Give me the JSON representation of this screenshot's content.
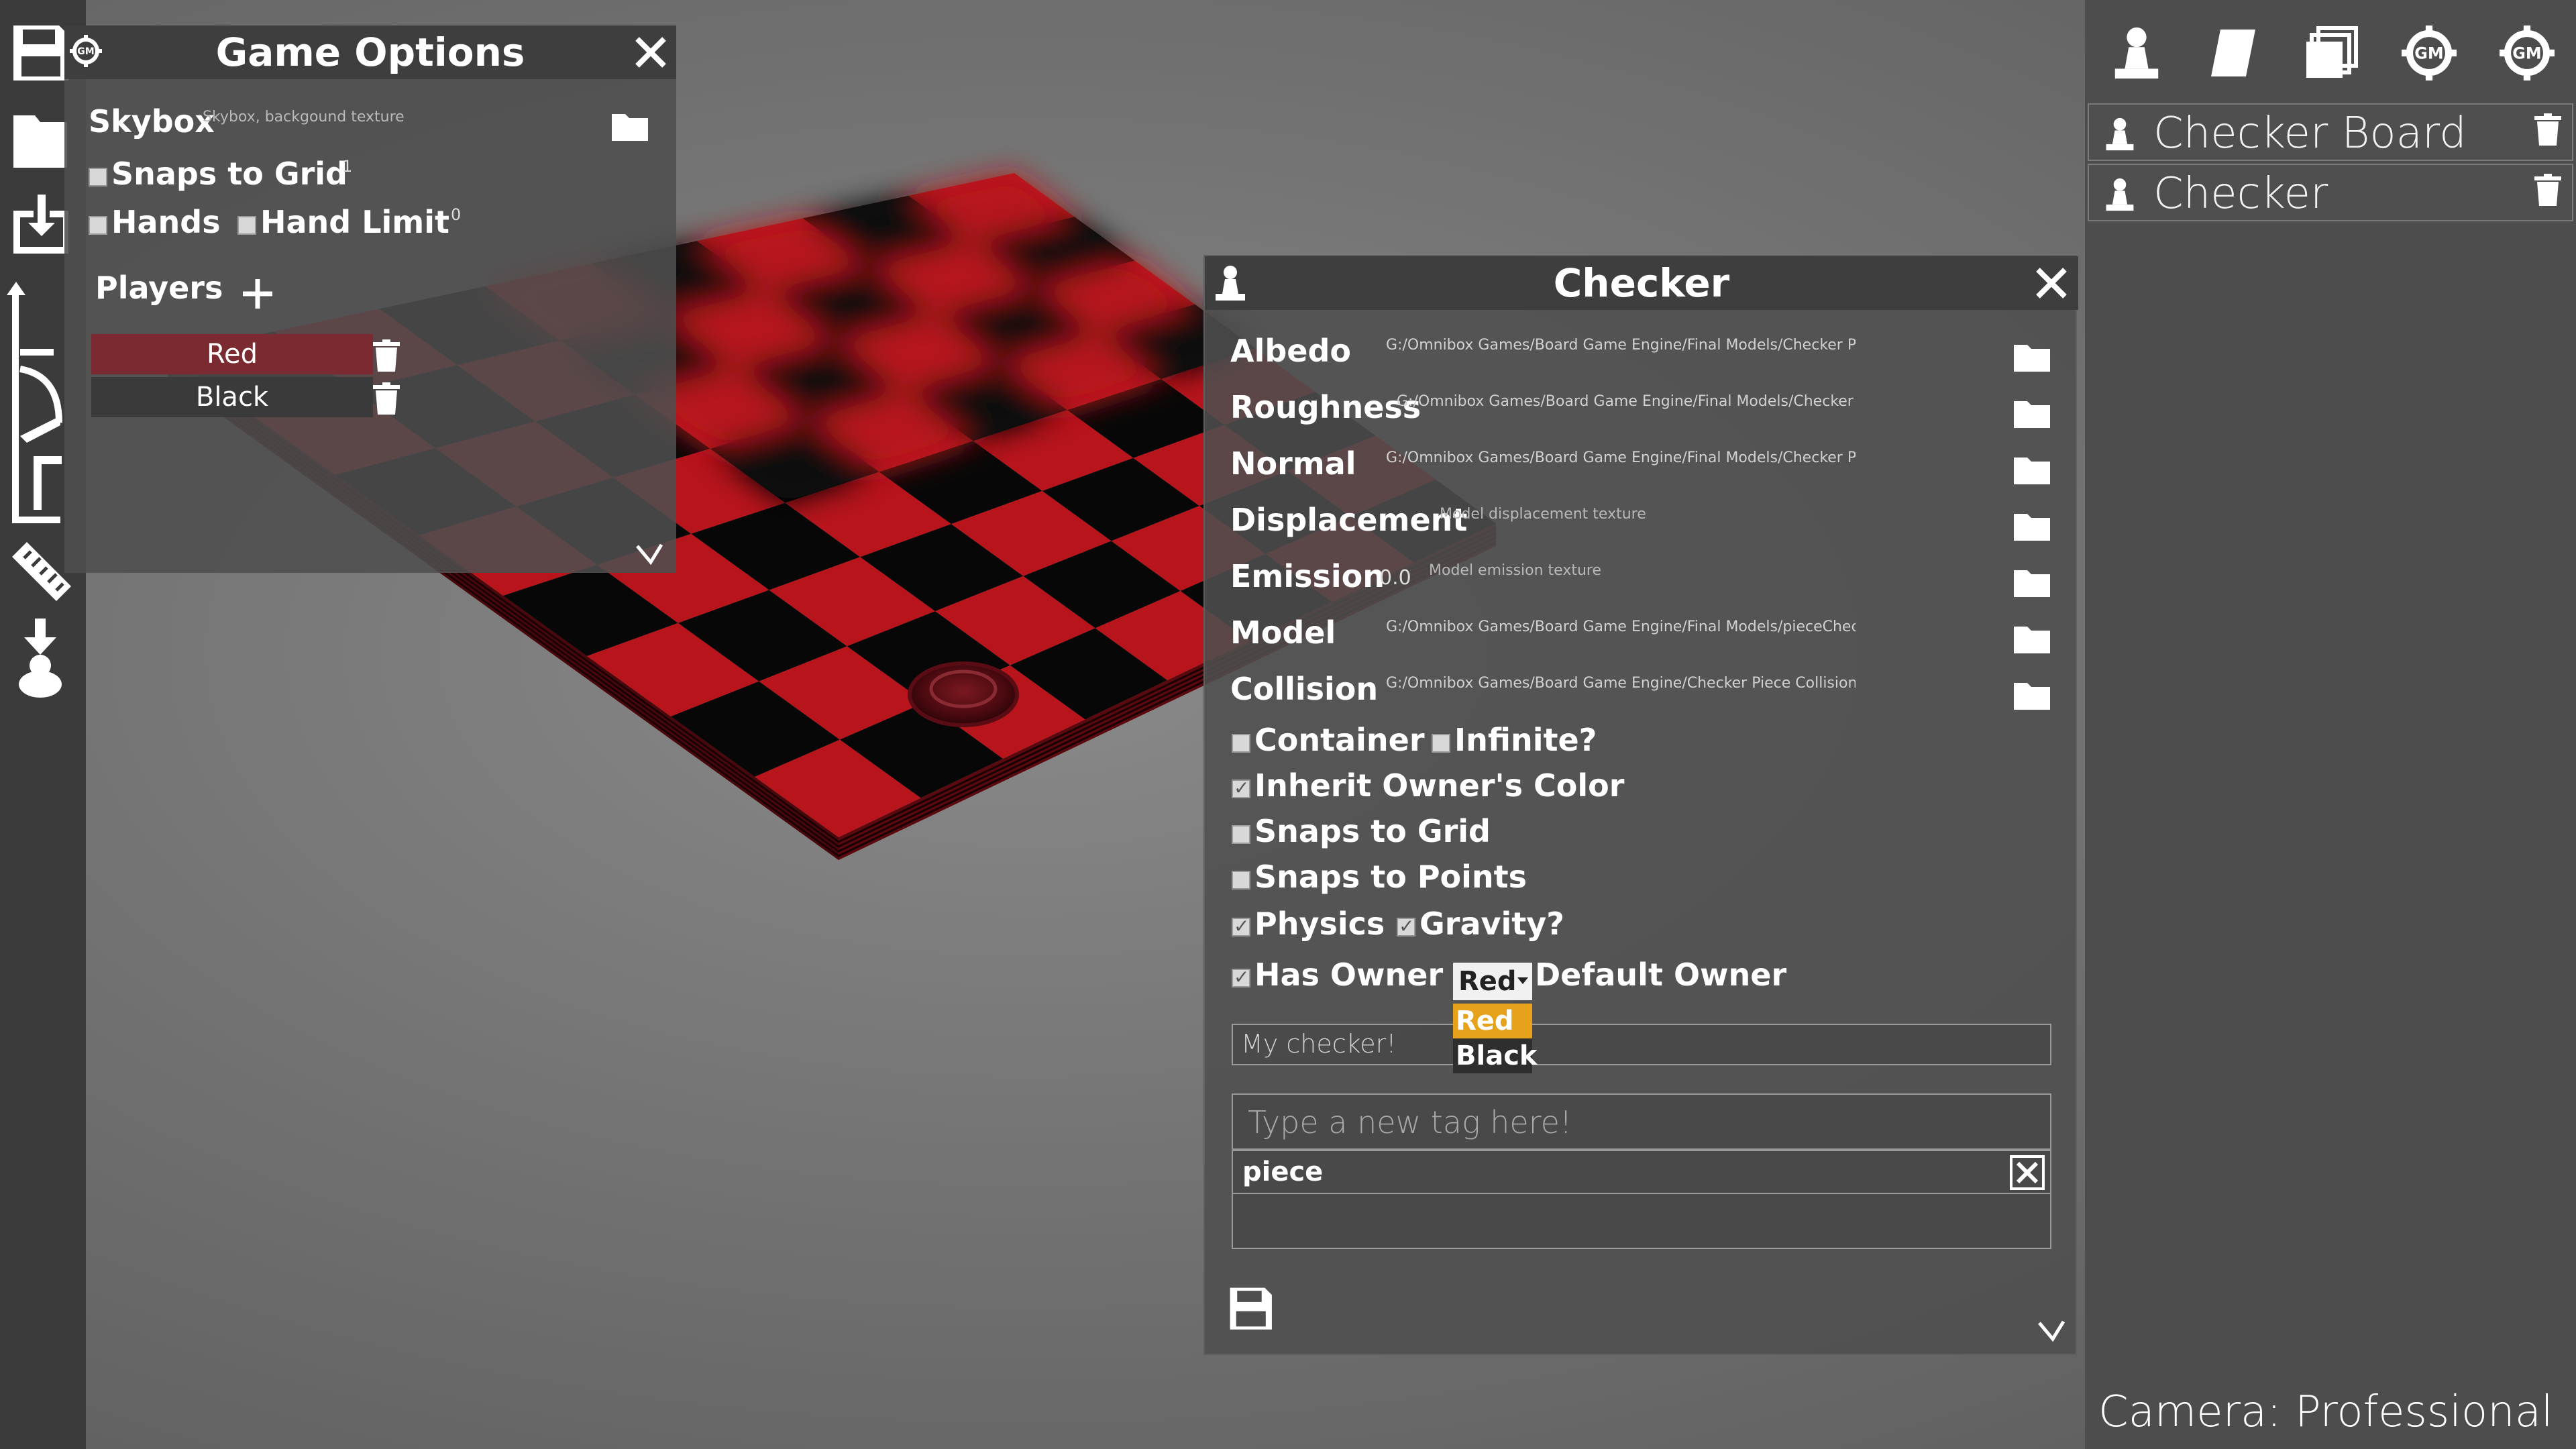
{
  "colors": {
    "board_red": "#b8141c",
    "board_black": "#070707",
    "panel_bg": "#4e4e4e",
    "header_bg": "#3e3e3e",
    "dropdown_highlight": "#e5a21a"
  },
  "left_toolbar": {
    "icons": [
      "save-icon",
      "folder-icon",
      "import-icon",
      "transform-icon",
      "ruler-icon",
      "spawn-icon"
    ]
  },
  "game_options": {
    "title": "Game Options",
    "skybox_label": "Skybox",
    "skybox_placeholder": "Skybox, backgound texture",
    "snaps_to_grid_label": "Snaps to Grid",
    "snaps_to_grid_value": "1",
    "snaps_to_grid_checked": false,
    "hands_label": "Hands",
    "hands_checked": false,
    "hand_limit_label": "Hand Limit",
    "hand_limit_checked": false,
    "hand_limit_value": "0",
    "players_label": "Players",
    "players": [
      {
        "name": "Red",
        "color": "#7a2a30"
      },
      {
        "name": "Black",
        "color": "#3a3a3a"
      }
    ]
  },
  "checker_panel": {
    "title": "Checker",
    "textures": [
      {
        "label": "Albedo",
        "path": "G:/Omnibox Games/Board Game Engine/Final Models/Checker Piece_Checker_Base",
        "placeholder": ""
      },
      {
        "label": "Roughness",
        "path": "G:/Omnibox Games/Board Game Engine/Final Models/Checker Piece_Checker_Rou",
        "placeholder": ""
      },
      {
        "label": "Normal",
        "path": "G:/Omnibox Games/Board Game Engine/Final Models/Checker Piece_Checker_Norm",
        "placeholder": ""
      },
      {
        "label": "Displacement",
        "path": "",
        "placeholder": "Model displacement texture"
      },
      {
        "label": "Emission",
        "path": "",
        "placeholder": "Model emission texture",
        "value": "0.0"
      },
      {
        "label": "Model",
        "path": "G:/Omnibox Games/Board Game Engine/Final Models/pieceChecker.fbx",
        "placeholder": ""
      },
      {
        "label": "Collision",
        "path": "G:/Omnibox Games/Board Game Engine/Checker Piece Collision.fbx",
        "placeholder": ""
      }
    ],
    "container_label": "Container",
    "container_checked": false,
    "infinite_label": "Infinite?",
    "infinite_checked": false,
    "inherit_color_label": "Inherit Owner's Color",
    "inherit_color_checked": true,
    "snaps_grid_label": "Snaps to Grid",
    "snaps_grid_checked": false,
    "snaps_points_label": "Snaps to Points",
    "snaps_points_checked": false,
    "physics_label": "Physics",
    "physics_checked": true,
    "gravity_label": "Gravity?",
    "gravity_checked": true,
    "has_owner_label": "Has Owner",
    "has_owner_checked": true,
    "owner_selected": "Red",
    "owner_options": [
      "Red",
      "Black"
    ],
    "default_owner_label": "Default Owner",
    "description_value": "My checker!",
    "tag_placeholder": "Type a new tag here!",
    "tags": [
      "piece"
    ]
  },
  "right_panel": {
    "top_icons": [
      "pawn-icon",
      "card-icon",
      "deck-icon",
      "gm-gear-icon",
      "gm-settings-icon"
    ],
    "objects": [
      {
        "name": "Checker Board"
      },
      {
        "name": "Checker"
      }
    ],
    "camera_label": "Camera: Professional"
  }
}
